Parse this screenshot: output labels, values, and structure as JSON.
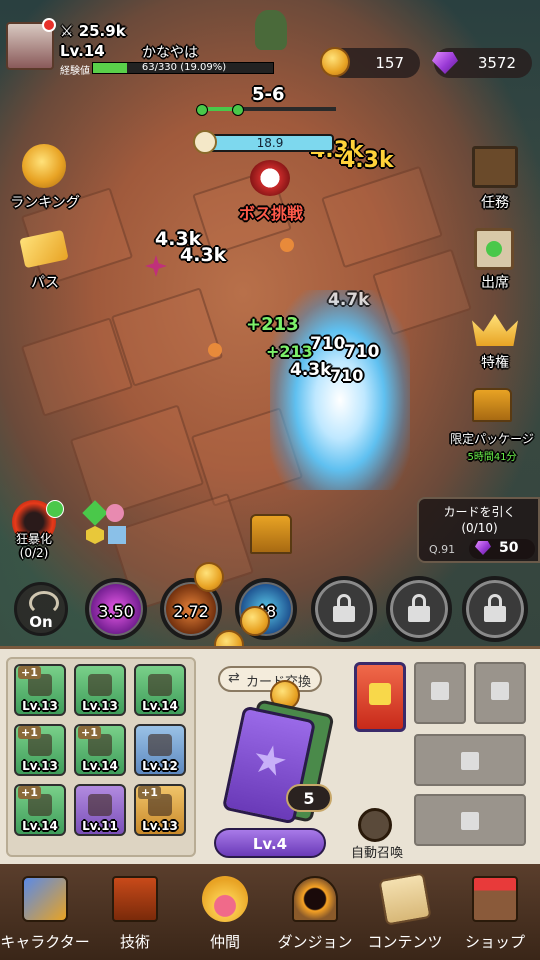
{
  "player": {
    "power": "25.9k",
    "level": "Lv.14",
    "name": "かなやは",
    "exp_label": "経験値",
    "exp_text": "63/330 (19.09%)",
    "exp_fraction": 0.19
  },
  "currency": {
    "coins": "157",
    "gems": "3572"
  },
  "stage": {
    "name": "5-6",
    "timer": "18.9",
    "boss_label": "ボス挑戦"
  },
  "left_menu": {
    "ranking": "ランキング",
    "pass": "パス",
    "rage": "狂暴化",
    "rage_count": "(0/2)"
  },
  "right_menu": {
    "missions": "任務",
    "attendance": "出席",
    "privilege": "特権",
    "limited_package": "限定パッケージ",
    "limited_timer": "5時間41分"
  },
  "damage_numbers": [
    "4.3k",
    "4.3k",
    "4.3k",
    "4.3k",
    "+213",
    "+213",
    "710",
    "710",
    "710",
    "4.3k",
    "4.7k"
  ],
  "draw_card": {
    "label": "カードを引く",
    "count": "(0/10)",
    "quota": "Q.91",
    "cost": "50"
  },
  "skills": {
    "auto_label": "On",
    "skill1": "3.50",
    "skill2": "2.72",
    "skill3": "48"
  },
  "cards": [
    {
      "plus": "+1",
      "lv": "Lv.13",
      "color": "g"
    },
    {
      "plus": "",
      "lv": "Lv.13",
      "color": "g"
    },
    {
      "plus": "",
      "lv": "Lv.14",
      "color": "g"
    },
    {
      "plus": "+1",
      "lv": "Lv.13",
      "color": "g"
    },
    {
      "plus": "+1",
      "lv": "Lv.14",
      "color": "g"
    },
    {
      "plus": "",
      "lv": "Lv.12",
      "color": "b"
    },
    {
      "plus": "+1",
      "lv": "Lv.14",
      "color": "g"
    },
    {
      "plus": "",
      "lv": "Lv.11",
      "color": "p"
    },
    {
      "plus": "+1",
      "lv": "Lv.13",
      "color": "y"
    }
  ],
  "deck": {
    "exchange_label": "カード交換",
    "count": "5",
    "level": "Lv.4",
    "auto_summon": "自動召喚"
  },
  "nav": [
    {
      "label": "キャラクター",
      "icon": "character-icon"
    },
    {
      "label": "技術",
      "icon": "skill-book-icon"
    },
    {
      "label": "仲間",
      "icon": "paw-icon"
    },
    {
      "label": "ダンジョン",
      "icon": "portal-icon"
    },
    {
      "label": "コンテンツ",
      "icon": "scroll-icon"
    },
    {
      "label": "ショップ",
      "icon": "shop-icon"
    }
  ]
}
